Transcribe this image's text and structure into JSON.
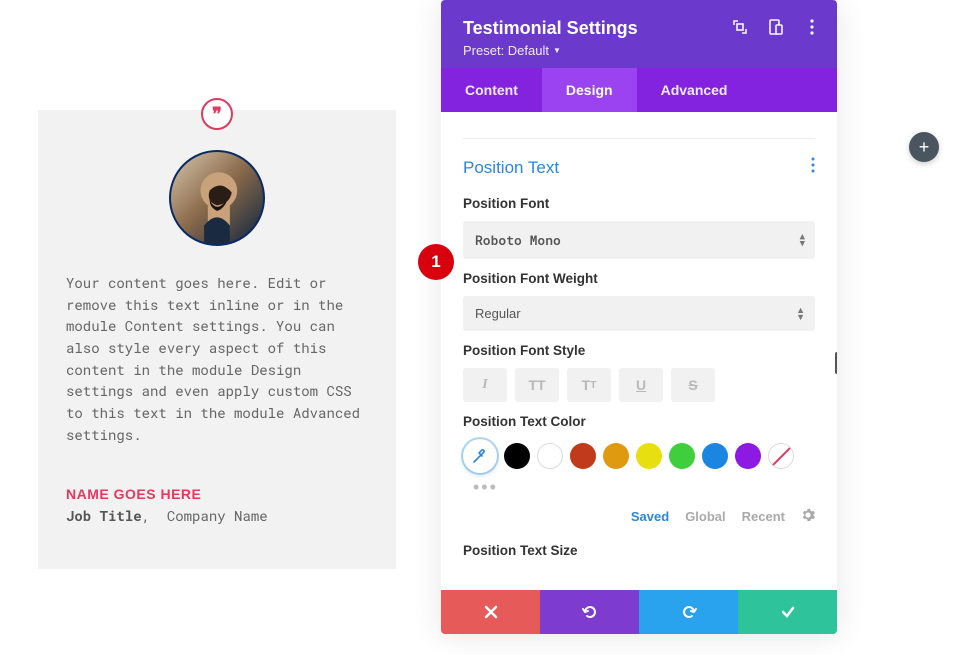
{
  "testimonial": {
    "body": "Your content goes here. Edit or remove this text inline or in the module Content settings. You can also style every aspect of this content in the module Design settings and even apply custom CSS to this text in the module Advanced settings.",
    "name": "NAME GOES HERE",
    "job_title": "Job Title",
    "company": "Company Name"
  },
  "panel": {
    "title": "Testimonial Settings",
    "preset_label": "Preset: Default",
    "tabs": {
      "content": "Content",
      "design": "Design",
      "advanced": "Advanced"
    },
    "section_title": "Position Text",
    "fields": {
      "font_label": "Position Font",
      "font_value": "Roboto Mono",
      "weight_label": "Position Font Weight",
      "weight_value": "Regular",
      "style_label": "Position Font Style",
      "color_label": "Position Text Color",
      "size_label": "Position Text Size"
    },
    "color_subtabs": {
      "saved": "Saved",
      "global": "Global",
      "recent": "Recent"
    },
    "swatches": [
      "#000000",
      "#ffffff",
      "#c13a1c",
      "#e09a10",
      "#e7df10",
      "#3fcf3c",
      "#1a86e2",
      "#8d1ae2"
    ]
  },
  "marker": "1"
}
